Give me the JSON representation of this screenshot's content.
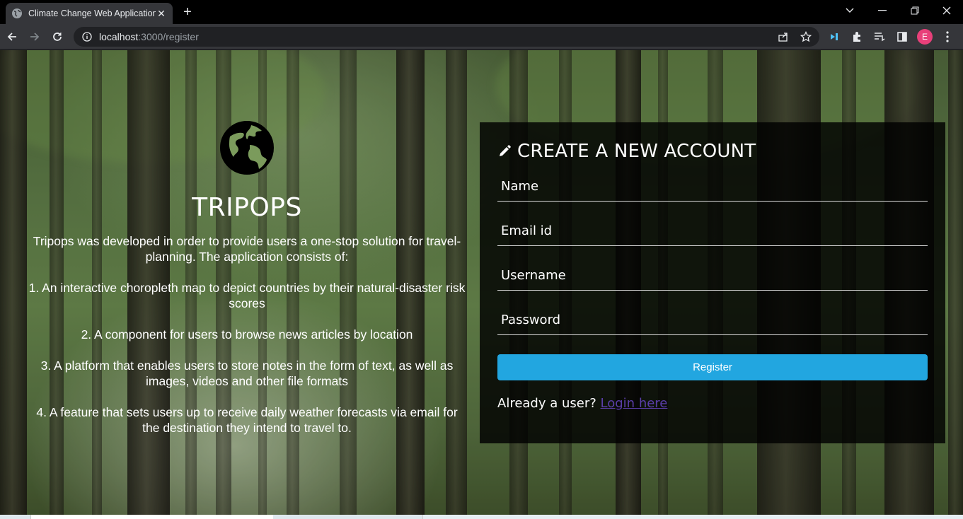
{
  "browser": {
    "tab_title": "Climate Change Web Application",
    "tab_close": "✕",
    "new_tab": "+",
    "url_host": "localhost",
    "url_rest": ":3000/register",
    "profile_initial": "E"
  },
  "intro": {
    "brand": "TRIPOPS",
    "description": "Tripops was developed in order to provide users a one-stop solution for travel-planning. The application consists of:",
    "features": [
      "1. An interactive choropleth map to depict countries by their natural-disaster risk scores",
      "2. A component for users to browse news articles by location",
      "3. A platform that enables users to store notes in the form of text, as well as images, videos and other file formats",
      "4. A feature that sets users up to receive daily weather forecasts via email for the destination they intend to travel to."
    ]
  },
  "form": {
    "title": "CREATE A NEW ACCOUNT",
    "name_placeholder": "Name",
    "email_placeholder": "Email id",
    "username_placeholder": "Username",
    "password_placeholder": "Password",
    "register_label": "Register",
    "already_text": "Already a user?",
    "login_link": "Login here"
  },
  "colors": {
    "accent": "#22a6e0",
    "link": "#5a3ea8",
    "panel": "#000000"
  }
}
